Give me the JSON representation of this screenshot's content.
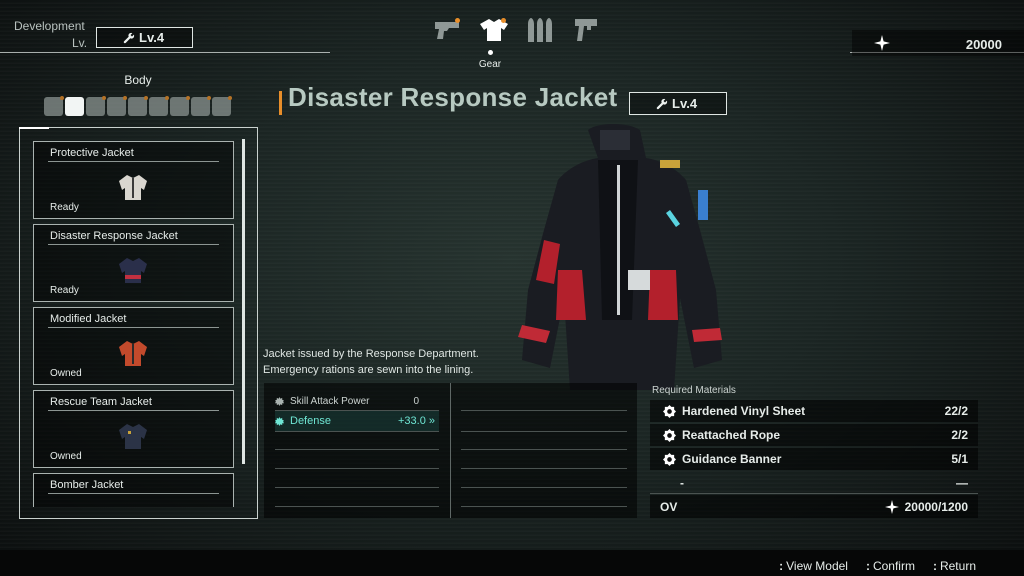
{
  "header": {
    "development_label": "Development",
    "lv_label": "Lv.",
    "development_level": "Lv.4",
    "tabs": [
      {
        "name": "pistol-icon",
        "active": false
      },
      {
        "name": "shirt-icon",
        "active": true
      },
      {
        "name": "ammo-icon",
        "active": false
      },
      {
        "name": "tool-icon",
        "active": false
      }
    ],
    "active_tab_label": "Gear",
    "currency_value": "20000"
  },
  "slot": {
    "title": "Body"
  },
  "items": [
    {
      "name": "Protective Jacket",
      "status": "Ready",
      "color": "#d9d6cf"
    },
    {
      "name": "Disaster Response Jacket",
      "status": "Ready",
      "color": "#2a2f4a"
    },
    {
      "name": "Modified Jacket",
      "status": "Owned",
      "color": "#c24a2c"
    },
    {
      "name": "Rescue Team Jacket",
      "status": "Owned",
      "color": "#2b3346"
    },
    {
      "name": "Bomber Jacket",
      "status": "",
      "color": "#333333"
    }
  ],
  "detail": {
    "title": "Disaster Response Jacket",
    "level": "Lv.4",
    "description_line1": "Jacket issued by the Response Department.",
    "description_line2": "Emergency rations are sewn into the lining.",
    "stats": [
      {
        "label": "Skill Attack Power",
        "value": "0",
        "highlight": false
      },
      {
        "label": "Defense",
        "value": "+33.0 »",
        "highlight": true
      }
    ]
  },
  "materials": {
    "title": "Required Materials",
    "rows": [
      {
        "name": "Hardened Vinyl Sheet",
        "count": "22/2"
      },
      {
        "name": "Reattached Rope",
        "count": "2/2"
      },
      {
        "name": "Guidance Banner",
        "count": "5/1"
      },
      {
        "name": "-",
        "count": "—"
      }
    ],
    "ov_label": "OV",
    "ov_value": "20000/1200"
  },
  "footer": {
    "prompts": [
      {
        "key": ":",
        "label": "View Model"
      },
      {
        "key": ":",
        "label": "Confirm"
      },
      {
        "key": ":",
        "label": "Return"
      }
    ]
  },
  "colors": {
    "accent_orange": "#e88e2a",
    "stat_highlight": "#6fe6d4",
    "title_text": "#b7c9c1"
  }
}
